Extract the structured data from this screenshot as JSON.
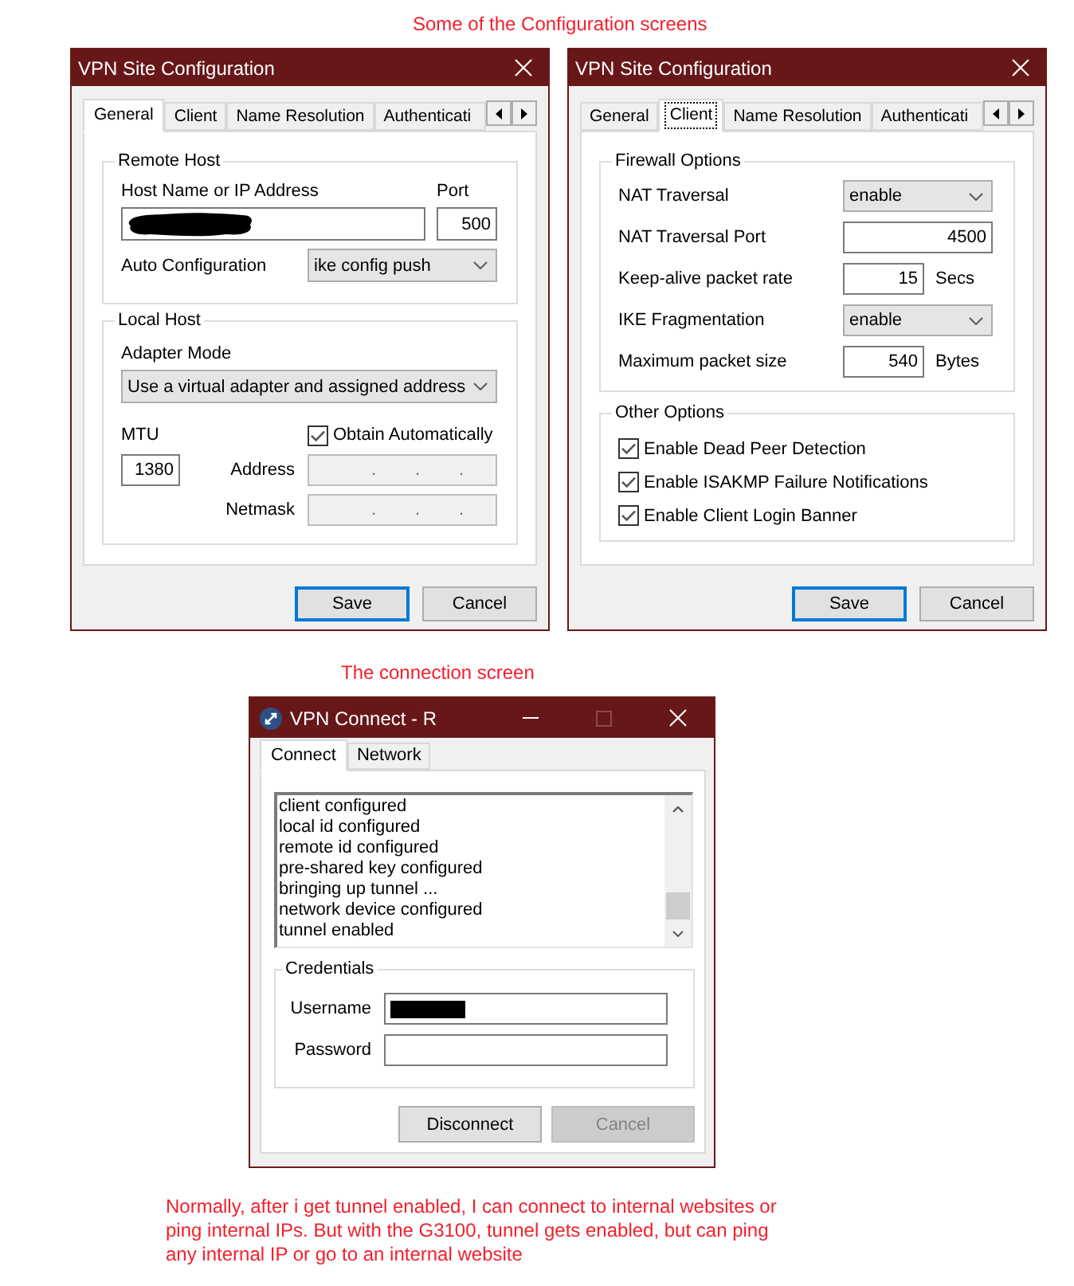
{
  "caption_top": "Some of the Configuration screens",
  "config_dialogs": [
    {
      "title": "VPN Site Configuration",
      "tabs": [
        {
          "label": "General",
          "selected": true,
          "focused": false
        },
        {
          "label": "Client",
          "selected": false,
          "focused": false
        },
        {
          "label": "Name Resolution",
          "selected": false,
          "focused": false
        },
        {
          "label": "Authenticati",
          "selected": false,
          "focused": false
        }
      ],
      "panel": {
        "kind": "general",
        "remote_host": {
          "legend": "Remote Host",
          "host": {
            "label": "Host Name or IP Address",
            "value_redacted": true
          },
          "port": {
            "label": "Port",
            "value": "500"
          },
          "auto_configuration": {
            "label": "Auto Configuration",
            "value": "ike config push"
          }
        },
        "local_host": {
          "legend": "Local Host",
          "adapter_mode": {
            "label": "Adapter Mode",
            "value": "Use a virtual adapter and assigned address"
          },
          "mtu": {
            "label": "MTU",
            "value": "1380"
          },
          "obtain_automatically": {
            "label": "Obtain Automatically",
            "checked": true
          },
          "address": {
            "label": "Address",
            "separator": ".",
            "disabled": true
          },
          "netmask": {
            "label": "Netmask",
            "separator": ".",
            "disabled": true
          }
        }
      },
      "buttons": [
        {
          "label": "Save",
          "default": true
        },
        {
          "label": "Cancel",
          "default": false
        }
      ]
    },
    {
      "title": "VPN Site Configuration",
      "tabs": [
        {
          "label": "General",
          "selected": false,
          "focused": false
        },
        {
          "label": "Client",
          "selected": true,
          "focused": true
        },
        {
          "label": "Name Resolution",
          "selected": false,
          "focused": false
        },
        {
          "label": "Authenticati",
          "selected": false,
          "focused": false
        }
      ],
      "panel": {
        "kind": "client",
        "firewall_options": {
          "legend": "Firewall Options",
          "rows": [
            {
              "kind": "dropdown",
              "label": "NAT Traversal",
              "value": "enable"
            },
            {
              "kind": "input",
              "label": "NAT Traversal Port",
              "value": "4500"
            },
            {
              "kind": "input",
              "label": "Keep-alive packet rate",
              "value": "15",
              "unit": "Secs"
            },
            {
              "kind": "dropdown",
              "label": "IKE Fragmentation",
              "value": "enable"
            },
            {
              "kind": "input",
              "label": "Maximum packet size",
              "value": "540",
              "unit": "Bytes"
            }
          ]
        },
        "other_options": {
          "legend": "Other Options",
          "checkboxes": [
            {
              "label": "Enable Dead Peer Detection",
              "checked": true
            },
            {
              "label": "Enable ISAKMP Failure Notifications",
              "checked": true
            },
            {
              "label": "Enable Client Login Banner",
              "checked": true
            }
          ]
        }
      },
      "buttons": [
        {
          "label": "Save",
          "default": true
        },
        {
          "label": "Cancel",
          "default": false
        }
      ]
    }
  ],
  "caption_middle": "The connection screen",
  "connect_window": {
    "title": "VPN Connect - R",
    "maximize_disabled": true,
    "tabs": [
      {
        "label": "Connect",
        "selected": true
      },
      {
        "label": "Network",
        "selected": false
      }
    ],
    "log": [
      "client configured",
      "local id configured",
      "remote id configured",
      "pre-shared key configured",
      "bringing up tunnel ...",
      "network device configured",
      "tunnel enabled"
    ],
    "credentials": {
      "legend": "Credentials",
      "fields": [
        {
          "label": "Username",
          "value_redacted": true
        },
        {
          "label": "Password",
          "value_redacted": false
        }
      ]
    },
    "buttons": [
      {
        "label": "Disconnect",
        "disabled": false
      },
      {
        "label": "Cancel",
        "disabled": true
      }
    ]
  },
  "note": "Normally, after i get tunnel enabled, I can connect to internal websites or\nping internal IPs. But with the G3100, tunnel gets enabled, but can ping\nany internal IP or go to an internal website"
}
